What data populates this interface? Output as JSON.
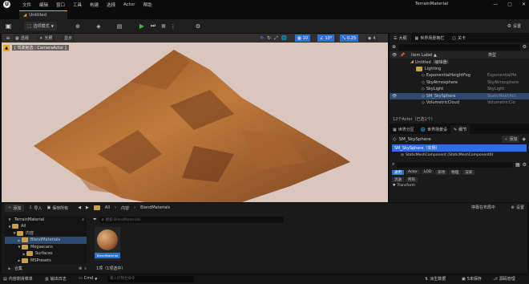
{
  "app": {
    "window_title": "TerrainMaterial",
    "menu": [
      "文件",
      "编辑",
      "窗口",
      "工具",
      "构建",
      "选择",
      "Actor",
      "帮助"
    ],
    "tab_title": "Untitled"
  },
  "toolbar": {
    "mode_label": "选项模式",
    "settings_label": "设置"
  },
  "viewport": {
    "perspective_label": "透视",
    "lit_label": "光照",
    "show_label": "显示",
    "camera_label": "[ 驾驶舱选 : CameraActor ]",
    "grid_value": "10",
    "angle_value": "10°",
    "scale_value": "0.25",
    "speed_value": "4"
  },
  "outliner": {
    "tabs": [
      "大纲",
      "世界场景格栏",
      "关卡"
    ],
    "col_label": "Item Label ▲",
    "col_type": "类型",
    "rows": [
      {
        "label": "Untitled（编辑器）",
        "type": "",
        "indent": 0,
        "icon": "level"
      },
      {
        "label": "Lighting",
        "type": "",
        "indent": 1,
        "icon": "folder"
      },
      {
        "label": "ExponentialHeightFog",
        "type": "ExponentialHe",
        "indent": 2,
        "icon": "actor"
      },
      {
        "label": "SkyAtmosphere",
        "type": "SkyAtmosphere",
        "indent": 2,
        "icon": "actor"
      },
      {
        "label": "SkyLight",
        "type": "SkyLight",
        "indent": 2,
        "icon": "actor"
      },
      {
        "label": "SM_SkySphere",
        "type": "StaticMeshAct",
        "indent": 2,
        "icon": "actor",
        "selected": true
      },
      {
        "label": "VolumetricCloud",
        "type": "VolumetricClo",
        "indent": 2,
        "icon": "actor"
      }
    ],
    "footer": "12个Actor（已选1个）"
  },
  "details": {
    "tabs": [
      "世界分区",
      "世界场景设",
      "细节"
    ],
    "actor_name": "SM_SkySphere",
    "add_label": "添加",
    "instance_label": "SM_SkySphere（实例）",
    "component_label": "StaticMeshComponent (StaticMeshComponent0)",
    "filters": [
      "通用",
      "Actor",
      "LOD",
      "杂项",
      "物理",
      "渲染"
    ],
    "filters2": [
      "流送",
      "所有"
    ],
    "section_label": "Transform"
  },
  "content_browser": {
    "add_label": "添加",
    "import_label": "导入",
    "save_all_label": "保存所有",
    "breadcrumb": [
      "All",
      "内容",
      "BlendMaterials"
    ],
    "tree_title": "TerrainMaterial",
    "tree": [
      {
        "label": "All",
        "indent": 0,
        "type": "root"
      },
      {
        "label": "内容",
        "indent": 1,
        "type": "folder"
      },
      {
        "label": "BlendMaterials",
        "indent": 2,
        "type": "folder",
        "selected": true
      },
      {
        "label": "Megascans",
        "indent": 2,
        "type": "folder"
      },
      {
        "label": "Surfaces",
        "indent": 3,
        "type": "folder"
      },
      {
        "label": "MSPresets",
        "indent": 2,
        "type": "folder"
      }
    ],
    "search_placeholder": "搜索 BlendMaterials",
    "asset_name": "BlendMaterial",
    "status": "1项（1项选中）",
    "collections_label": "合集",
    "layout_label": "停靠在布局中",
    "settings_label": "设置"
  },
  "statusbar": {
    "drawer_label": "内容侧滑菜单",
    "log_label": "输出日志",
    "cmd_label": "Cmd",
    "cmd_placeholder": "输入控制台命令",
    "derived_label": "派生数据",
    "unsaved_label": "5未保存",
    "source_label": "源码管理"
  },
  "colors": {
    "accent": "#2e6fd8",
    "play_green": "#4cb04c",
    "folder": "#c9a04a",
    "terrain": "#b8743a",
    "sky": "#d9c6bf"
  }
}
